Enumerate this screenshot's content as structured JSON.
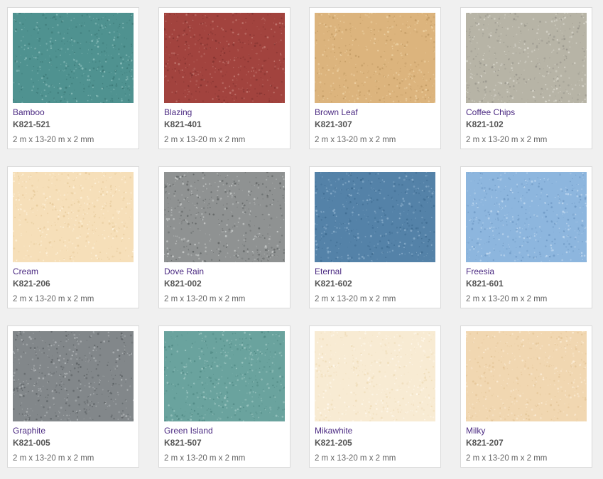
{
  "theme": {
    "name_color": "#4b2a82",
    "code_color": "#555555",
    "dims_color": "#666666"
  },
  "products": [
    {
      "name": "Bamboo",
      "code": "K821-521",
      "dimensions": "2 m x 13-20 m x 2 mm",
      "base": "#4f9290",
      "dark": "#3c7876",
      "light": "#8fc0bd"
    },
    {
      "name": "Blazing",
      "code": "K821-401",
      "dimensions": "2 m x 13-20 m x 2 mm",
      "base": "#a2433e",
      "dark": "#833330",
      "light": "#c27a72"
    },
    {
      "name": "Brown Leaf",
      "code": "K821-307",
      "dimensions": "2 m x 13-20 m x 2 mm",
      "base": "#dcb47d",
      "dark": "#c19a63",
      "light": "#eed3a6"
    },
    {
      "name": "Coffee Chips",
      "code": "K821-102",
      "dimensions": "2 m x 13-20 m x 2 mm",
      "base": "#b7b4a6",
      "dark": "#96938a",
      "light": "#dcdad0"
    },
    {
      "name": "Cream",
      "code": "K821-206",
      "dimensions": "2 m x 13-20 m x 2 mm",
      "base": "#f6dfb9",
      "dark": "#e6c999",
      "light": "#fff4de"
    },
    {
      "name": "Dove Rain",
      "code": "K821-002",
      "dimensions": "2 m x 13-20 m x 2 mm",
      "base": "#8f9292",
      "dark": "#5e6262",
      "light": "#c9cccb"
    },
    {
      "name": "Eternal",
      "code": "K821-602",
      "dimensions": "2 m x 13-20 m x 2 mm",
      "base": "#5482a8",
      "dark": "#3d6a8f",
      "light": "#8fb2ce"
    },
    {
      "name": "Freesia",
      "code": "K821-601",
      "dimensions": "2 m x 13-20 m x 2 mm",
      "base": "#8db6de",
      "dark": "#6e98c4",
      "light": "#c3daf0"
    },
    {
      "name": "Graphite",
      "code": "K821-005",
      "dimensions": "2 m x 13-20 m x 2 mm",
      "base": "#82878a",
      "dark": "#5a5f62",
      "light": "#b8bcbe"
    },
    {
      "name": "Green Island",
      "code": "K821-507",
      "dimensions": "2 m x 13-20 m x 2 mm",
      "base": "#6aa39e",
      "dark": "#4f8883",
      "light": "#a4cbc6"
    },
    {
      "name": "Mikawhite",
      "code": "K821-205",
      "dimensions": "2 m x 13-20 m x 2 mm",
      "base": "#f8ebd3",
      "dark": "#eedbb6",
      "light": "#fffaf0"
    },
    {
      "name": "Milky",
      "code": "K821-207",
      "dimensions": "2 m x 13-20 m x 2 mm",
      "base": "#f1d7b1",
      "dark": "#e3c496",
      "light": "#fbecd6"
    }
  ]
}
